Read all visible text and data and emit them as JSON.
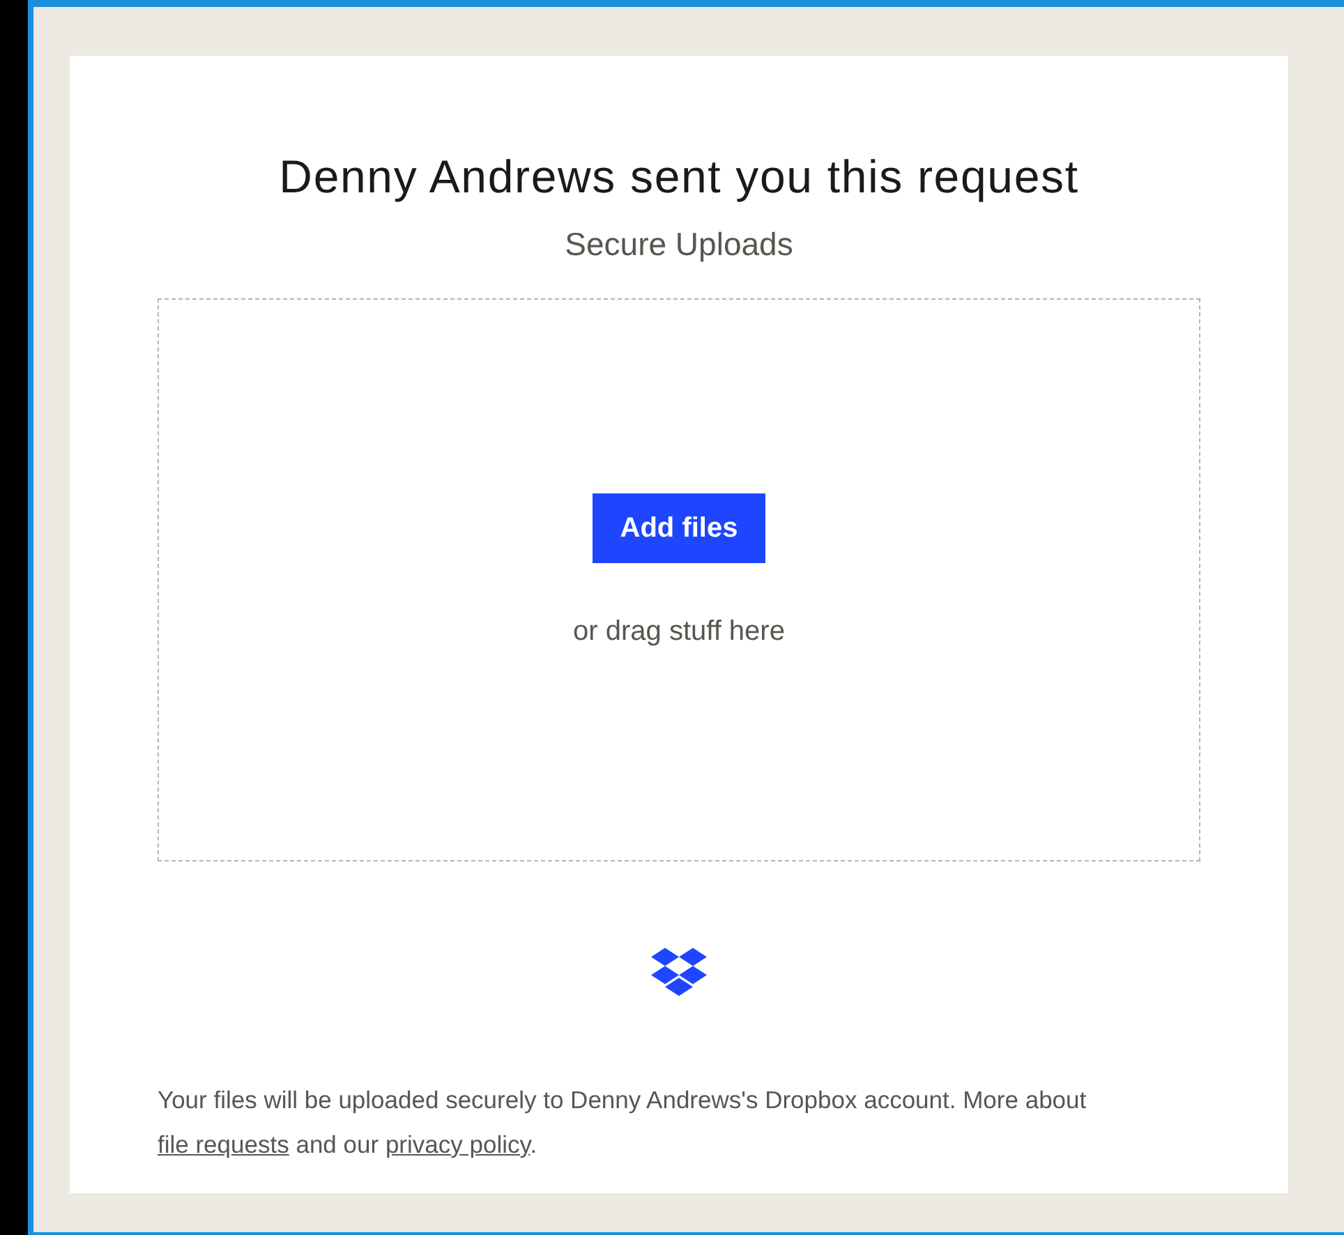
{
  "title": "Denny Andrews sent you this request",
  "subtitle": "Secure Uploads",
  "dropzone": {
    "button": "Add files",
    "hint": "or drag stuff here"
  },
  "footer": [
    {
      "kind": "text",
      "text": "Your files will be uploaded securely to Denny Andrews's Dropbox account. More about "
    },
    {
      "kind": "link",
      "text": "file requests"
    },
    {
      "kind": "text",
      "text": " and our "
    },
    {
      "kind": "link",
      "text": "privacy policy"
    },
    {
      "kind": "text",
      "text": "."
    }
  ]
}
